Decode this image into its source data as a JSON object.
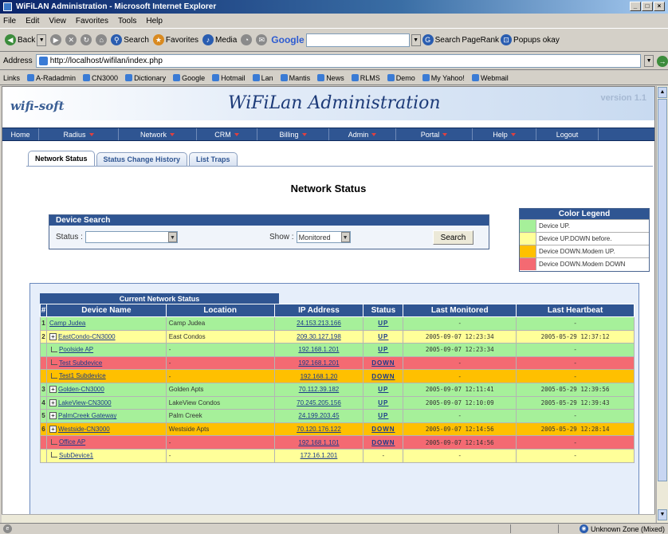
{
  "window": {
    "title": "WiFiLAN Administration - Microsoft Internet Explorer"
  },
  "menubar": [
    "File",
    "Edit",
    "View",
    "Favorites",
    "Tools",
    "Help"
  ],
  "toolbar": {
    "back": "Back",
    "search": "Search",
    "favorites": "Favorites",
    "media": "Media",
    "google_logo": "Google",
    "gsearch": "Search",
    "pagerank": "PageRank",
    "popups": "Popups okay"
  },
  "address": {
    "label": "Address",
    "url": "http://localhost/wifilan/index.php"
  },
  "links": {
    "label": "Links",
    "items": [
      "A-Radadmin",
      "CN3000",
      "Dictionary",
      "Google",
      "Hotmail",
      "Lan",
      "Mantis",
      "News",
      "RLMS",
      "Demo",
      "My Yahoo!",
      "Webmail"
    ]
  },
  "page": {
    "logo": "wifi-soft",
    "app_title": "WiFiLan Administration",
    "version": "version 1.1",
    "nav": [
      {
        "label": "Home",
        "caret": false
      },
      {
        "label": "Radius",
        "caret": true
      },
      {
        "label": "Network",
        "caret": true
      },
      {
        "label": "CRM",
        "caret": true
      },
      {
        "label": "Billing",
        "caret": true
      },
      {
        "label": "Admin",
        "caret": true
      },
      {
        "label": "Portal",
        "caret": true
      },
      {
        "label": "Help",
        "caret": true
      },
      {
        "label": "Logout",
        "caret": false
      }
    ],
    "tabs": [
      "Network Status",
      "Status Change History",
      "List Traps"
    ],
    "title": "Network Status",
    "device_search": {
      "header": "Device Search",
      "status_label": "Status :",
      "status_value": "",
      "show_label": "Show :",
      "show_value": "Monitored",
      "search_button": "Search"
    },
    "legend": {
      "header": "Color Legend",
      "items": [
        {
          "color": "#a6f09a",
          "label": "Device UP."
        },
        {
          "color": "#ffff99",
          "label": "Device UP.DOWN before."
        },
        {
          "color": "#ffc000",
          "label": "Device DOWN.Modem UP."
        },
        {
          "color": "#f46a72",
          "label": "Device DOWN.Modem DOWN"
        }
      ]
    },
    "network": {
      "header": "Current Network Status",
      "columns": [
        "#",
        "Device Name",
        "Location",
        "IP Address",
        "Status",
        "Last Monitored",
        "Last Heartbeat"
      ],
      "rows": [
        {
          "num": "1",
          "expand": false,
          "child": false,
          "name": "Camp Judea",
          "location": "Camp Judea",
          "ip": "24.153.213.166",
          "status": "UP",
          "last_monitored": "-",
          "last_heartbeat": "-",
          "color": "green"
        },
        {
          "num": "2",
          "expand": true,
          "child": false,
          "name": "EastCondo-CN3000",
          "location": "East Condos",
          "ip": "209.30.127.198",
          "status": "UP",
          "last_monitored": "2005-09-07 12:23:34",
          "last_heartbeat": "2005-05-29 12:37:12",
          "color": "yellow"
        },
        {
          "num": "",
          "expand": false,
          "child": true,
          "name": "Poolside AP",
          "location": "-",
          "ip": "192.168.1.201",
          "status": "UP",
          "last_monitored": "2005-09-07 12:23:34",
          "last_heartbeat": "-",
          "color": "green"
        },
        {
          "num": "",
          "expand": false,
          "child": true,
          "name": "Test Subdevice",
          "location": "-",
          "ip": "192.168.1.201",
          "status": "DOWN",
          "last_monitored": "-",
          "last_heartbeat": "-",
          "color": "red"
        },
        {
          "num": "",
          "expand": false,
          "child": true,
          "name": "Test1 Subdevice",
          "location": "-",
          "ip": "192.168.1.20",
          "status": "DOWN",
          "last_monitored": "-",
          "last_heartbeat": "-",
          "color": "orange"
        },
        {
          "num": "3",
          "expand": true,
          "child": false,
          "name": "Golden-CN3000",
          "location": "Golden Apts",
          "ip": "70.112.39.182",
          "status": "UP",
          "last_monitored": "2005-09-07 12:11:41",
          "last_heartbeat": "2005-05-29 12:39:56",
          "color": "green"
        },
        {
          "num": "4",
          "expand": true,
          "child": false,
          "name": "LakeView-CN3000",
          "location": "LakeView Condos",
          "ip": "70.245.205.156",
          "status": "UP",
          "last_monitored": "2005-09-07 12:10:09",
          "last_heartbeat": "2005-05-29 12:39:43",
          "color": "green"
        },
        {
          "num": "5",
          "expand": true,
          "child": false,
          "name": "PalmCreek Gateway",
          "location": "Palm Creek",
          "ip": "24.199.203.45",
          "status": "UP",
          "last_monitored": "-",
          "last_heartbeat": "-",
          "color": "green"
        },
        {
          "num": "6",
          "expand": true,
          "child": false,
          "name": "Westside-CN3000",
          "location": "Westside Apts",
          "ip": "70.120.176.122",
          "status": "DOWN",
          "last_monitored": "2005-09-07 12:14:56",
          "last_heartbeat": "2005-05-29 12:28:14",
          "color": "orange"
        },
        {
          "num": "",
          "expand": false,
          "child": true,
          "name": "Office AP",
          "location": "-",
          "ip": "192.168.1.101",
          "status": "DOWN",
          "last_monitored": "2005-09-07 12:14:56",
          "last_heartbeat": "-",
          "color": "red"
        },
        {
          "num": "",
          "expand": false,
          "child": true,
          "name": "SubDevice1",
          "location": "-",
          "ip": "172.16.1.201",
          "status": "-",
          "last_monitored": "-",
          "last_heartbeat": "-",
          "color": "yellow"
        }
      ]
    }
  },
  "statusbar": {
    "zone": "Unknown Zone (Mixed)"
  }
}
